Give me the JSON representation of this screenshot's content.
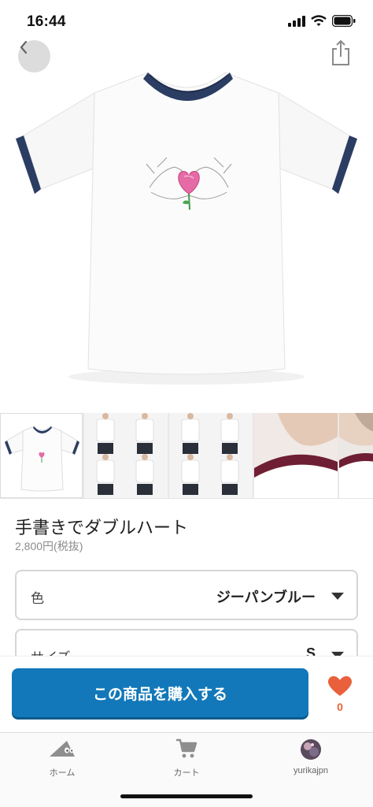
{
  "status_bar": {
    "time": "16:44"
  },
  "product": {
    "title": "手書きでダブルハート",
    "price": "2,800円(税抜)"
  },
  "options": [
    {
      "label": "色",
      "value": "ジーパンブルー"
    },
    {
      "label": "サイズ",
      "value": "S"
    }
  ],
  "purchase": {
    "buy_label": "この商品を購入する",
    "like_count": "0"
  },
  "tabs": [
    {
      "label": "ホーム"
    },
    {
      "label": "カート"
    },
    {
      "label": "yurikajpn"
    }
  ],
  "colors": {
    "accent": "#1278b9",
    "like": "#e8603c",
    "ringer_trim": "#2b3d63"
  }
}
